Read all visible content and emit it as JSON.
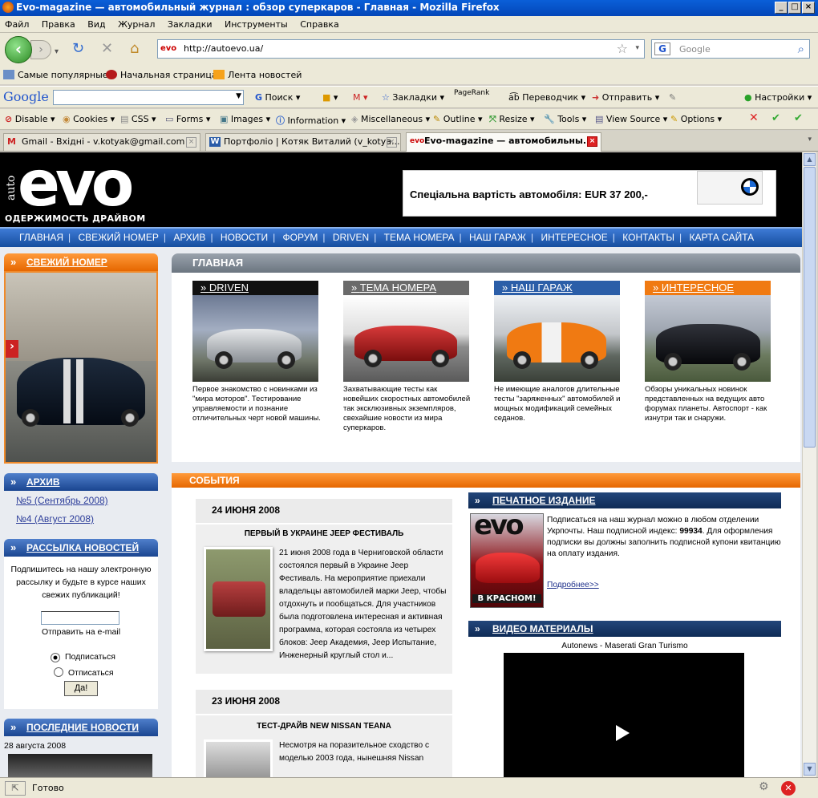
{
  "window": {
    "title": "Evo-magazine — автомобильный журнал : обзор суперкаров - Главная - Mozilla Firefox"
  },
  "menu": [
    "Файл",
    "Правка",
    "Вид",
    "Журнал",
    "Закладки",
    "Инструменты",
    "Справка"
  ],
  "nav": {
    "url": "http://autoevo.ua/",
    "search_placeholder": "Google"
  },
  "bookmarks": [
    "Самые популярные",
    "Начальная страница",
    "Лента новостей"
  ],
  "google_toolbar": {
    "logo": "Google",
    "items": [
      "Поиск",
      "Закладки",
      "PageRank",
      "Переводчик",
      "Отправить",
      "Настройки"
    ]
  },
  "webdev_toolbar": {
    "items": [
      "Disable",
      "Cookies",
      "CSS",
      "Forms",
      "Images",
      "Information",
      "Miscellaneous",
      "Outline",
      "Resize",
      "Tools",
      "View Source",
      "Options"
    ]
  },
  "tabs": [
    {
      "label": "Gmail - Вхідні - v.kotyak@gmail.com"
    },
    {
      "label": "Портфоліо | Котяк Виталий (v_kotya..."
    },
    {
      "label": "Evo-magazine — автомобильны..."
    }
  ],
  "status": "Готово",
  "site": {
    "logo_prefix": "auto",
    "logo": "evo",
    "tagline": "ОДЕРЖИМОСТЬ ДРАЙВОМ",
    "ad_text": "Спеціальна вартість автомобіля: EUR 37 200,-",
    "nav": [
      "ГЛАВНАЯ",
      "СВЕЖИЙ НОМЕР",
      "АРХИВ",
      "НОВОСТИ",
      "ФОРУМ",
      "DRIVEN",
      "ТЕМА НОМЕРА",
      "НАШ ГАРАЖ",
      "ИНТЕРЕСНОЕ",
      "КОНТАКТЫ",
      "КАРТА САЙТА"
    ],
    "sidebar": {
      "fresh_title": "СВЕЖИЙ НОМЕР",
      "archive_title": "АРХИВ",
      "archive_links": [
        "№5 (Сентябрь 2008)",
        "№4 (Август 2008)"
      ],
      "newsletter_title": "РАССЫЛКА НОВОСТЕЙ",
      "newsletter_text": "Подпишитесь на нашу электронную рассылку и будьте в курсе наших свежих публикаций!",
      "email_label": "Отправить на e-mail",
      "subscribe": "Подписаться",
      "unsubscribe": "Отписаться",
      "submit": "Да!",
      "latest_title": "ПОСЛЕДНИЕ НОВОСТИ",
      "latest_date": "28 августа 2008"
    },
    "main": {
      "title": "ГЛАВНАЯ",
      "categories": [
        {
          "title": "DRIVEN",
          "color": "#111111",
          "text": "Первое знакомство с новинками из \"мира моторов\". Тестирование управляемости и познание отличительных черт новой машины."
        },
        {
          "title": "ТЕМА НОМЕРА",
          "color": "#6a6a6a",
          "text": "Захватывающие тесты как новейших скоростных автомобилей так эксклюзивных экземпляров, свехайшие новости из мира суперкаров."
        },
        {
          "title": "НАШ ГАРАЖ",
          "color": "#2b5ea8",
          "text": "Не имеющие аналогов длительные тесты \"заряженных\" автомобилей и мощных модификаций семейных седанов."
        },
        {
          "title": "ИНТЕРЕСНОЕ",
          "color": "#f07a12",
          "text": "Обзоры уникальных новинок представленных на ведущих авто форумах планеты. Автоспорт - как изнутри так и снаружи."
        }
      ],
      "events_title": "СОБЫТИЯ",
      "events": [
        {
          "date": "24 ИЮНЯ 2008",
          "headline": "ПЕРВЫЙ В УКРАИНЕ JEEP ФЕСТИВАЛЬ",
          "text": "21 июня 2008 года в Черниговской области состоялся первый в Украине Jeep Фестиваль. На мероприятие приехали владельцы автомобилей марки Jeep, чтобы отдохнуть и пообщаться. Для участников была подготовлена интересная и активная программа, которая состояла из четырех блоков: Jeep Академия, Jeep Испытание, Инженерный круглый стол и..."
        },
        {
          "date": "23 ИЮНЯ 2008",
          "headline": "ТЕСТ-ДРАЙВ NEW NISSAN TEANA",
          "text": "Несмотря на поразительное сходство с моделью 2003 года, нынешняя Nissan"
        }
      ],
      "print": {
        "title": "ПЕЧАТНОЕ ИЗДАНИЕ",
        "text": "Подписаться на наш журнал можно в любом отделении Укрпочты. Наш подписной индекс:",
        "index": "99934",
        "text2": ". Для оформления подписки вы должны заполнить подписной купони квитанцию на оплату издания.",
        "more": "Подробнее>>",
        "cover_logo": "evo",
        "cover_caption": "В КРАСНОМ!"
      },
      "video": {
        "title": "ВИДЕО МАТЕРИАЛЫ",
        "caption": "Autonews - Maserati Gran Turismo"
      }
    }
  }
}
